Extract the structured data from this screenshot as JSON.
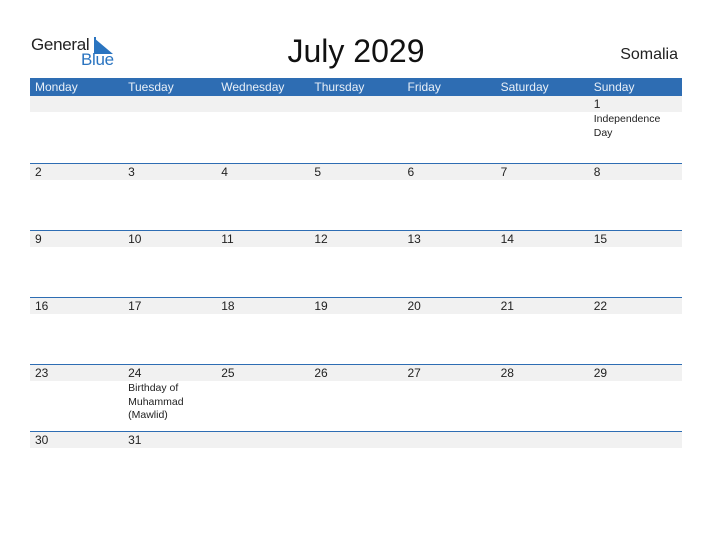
{
  "logo": {
    "line1": "General",
    "line2": "Blue"
  },
  "title": "July 2029",
  "country": "Somalia",
  "colors": {
    "accent": "#2e6db3",
    "strip": "#f1f1f1"
  },
  "weekdays": [
    "Monday",
    "Tuesday",
    "Wednesday",
    "Thursday",
    "Friday",
    "Saturday",
    "Sunday"
  ],
  "weeks": [
    [
      {
        "day": "",
        "event": ""
      },
      {
        "day": "",
        "event": ""
      },
      {
        "day": "",
        "event": ""
      },
      {
        "day": "",
        "event": ""
      },
      {
        "day": "",
        "event": ""
      },
      {
        "day": "",
        "event": ""
      },
      {
        "day": "1",
        "event": "Independence Day"
      }
    ],
    [
      {
        "day": "2",
        "event": ""
      },
      {
        "day": "3",
        "event": ""
      },
      {
        "day": "4",
        "event": ""
      },
      {
        "day": "5",
        "event": ""
      },
      {
        "day": "6",
        "event": ""
      },
      {
        "day": "7",
        "event": ""
      },
      {
        "day": "8",
        "event": ""
      }
    ],
    [
      {
        "day": "9",
        "event": ""
      },
      {
        "day": "10",
        "event": ""
      },
      {
        "day": "11",
        "event": ""
      },
      {
        "day": "12",
        "event": ""
      },
      {
        "day": "13",
        "event": ""
      },
      {
        "day": "14",
        "event": ""
      },
      {
        "day": "15",
        "event": ""
      }
    ],
    [
      {
        "day": "16",
        "event": ""
      },
      {
        "day": "17",
        "event": ""
      },
      {
        "day": "18",
        "event": ""
      },
      {
        "day": "19",
        "event": ""
      },
      {
        "day": "20",
        "event": ""
      },
      {
        "day": "21",
        "event": ""
      },
      {
        "day": "22",
        "event": ""
      }
    ],
    [
      {
        "day": "23",
        "event": ""
      },
      {
        "day": "24",
        "event": "Birthday of Muhammad (Mawlid)"
      },
      {
        "day": "25",
        "event": ""
      },
      {
        "day": "26",
        "event": ""
      },
      {
        "day": "27",
        "event": ""
      },
      {
        "day": "28",
        "event": ""
      },
      {
        "day": "29",
        "event": ""
      }
    ],
    [
      {
        "day": "30",
        "event": ""
      },
      {
        "day": "31",
        "event": ""
      },
      {
        "day": "",
        "event": ""
      },
      {
        "day": "",
        "event": ""
      },
      {
        "day": "",
        "event": ""
      },
      {
        "day": "",
        "event": ""
      },
      {
        "day": "",
        "event": ""
      }
    ]
  ]
}
